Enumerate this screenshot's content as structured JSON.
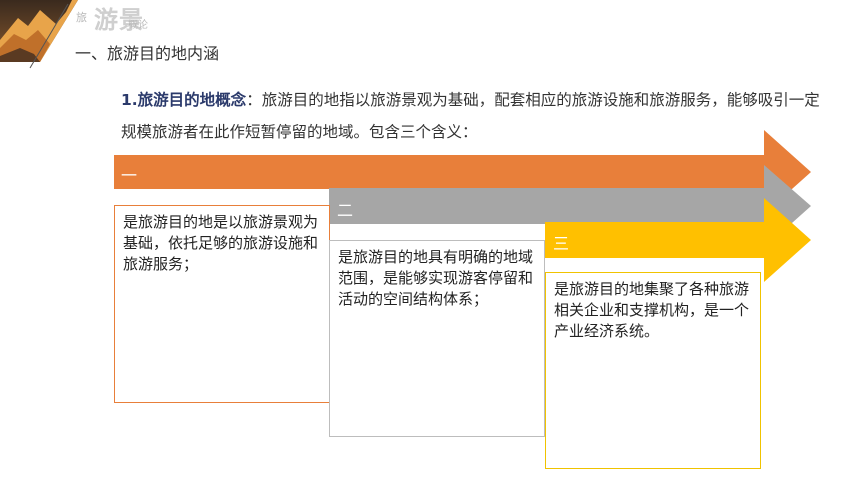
{
  "header": {
    "logo_big": "游景",
    "logo_small": "旅",
    "logo_small2": "概论",
    "section_title": "一、旅游目的地内涵"
  },
  "intro": {
    "keyword": "1.旅游目的地概念",
    "colon": "：",
    "text": "旅游目的地指以旅游景观为基础，配套相应的旅游设施和旅游服务，能够吸引一定规模旅游者在此作短暂停留的地域。包含三个含义："
  },
  "steps": [
    {
      "label": "一",
      "text": "是旅游目的地是以旅游景观为基础，依托足够的旅游设施和旅游服务；"
    },
    {
      "label": "二",
      "text": "是旅游目的地具有明确的地域范围，是能够实现游客停留和活动的空间结构体系；"
    },
    {
      "label": "三",
      "text": "是旅游目的地集聚了各种旅游相关企业和支撑机构，是一个产业经济系统。"
    }
  ],
  "colors": {
    "orange": "#e87f3a",
    "gray": "#a6a6a6",
    "yellow": "#ffc000",
    "title_blue": "#2b3a6b"
  }
}
